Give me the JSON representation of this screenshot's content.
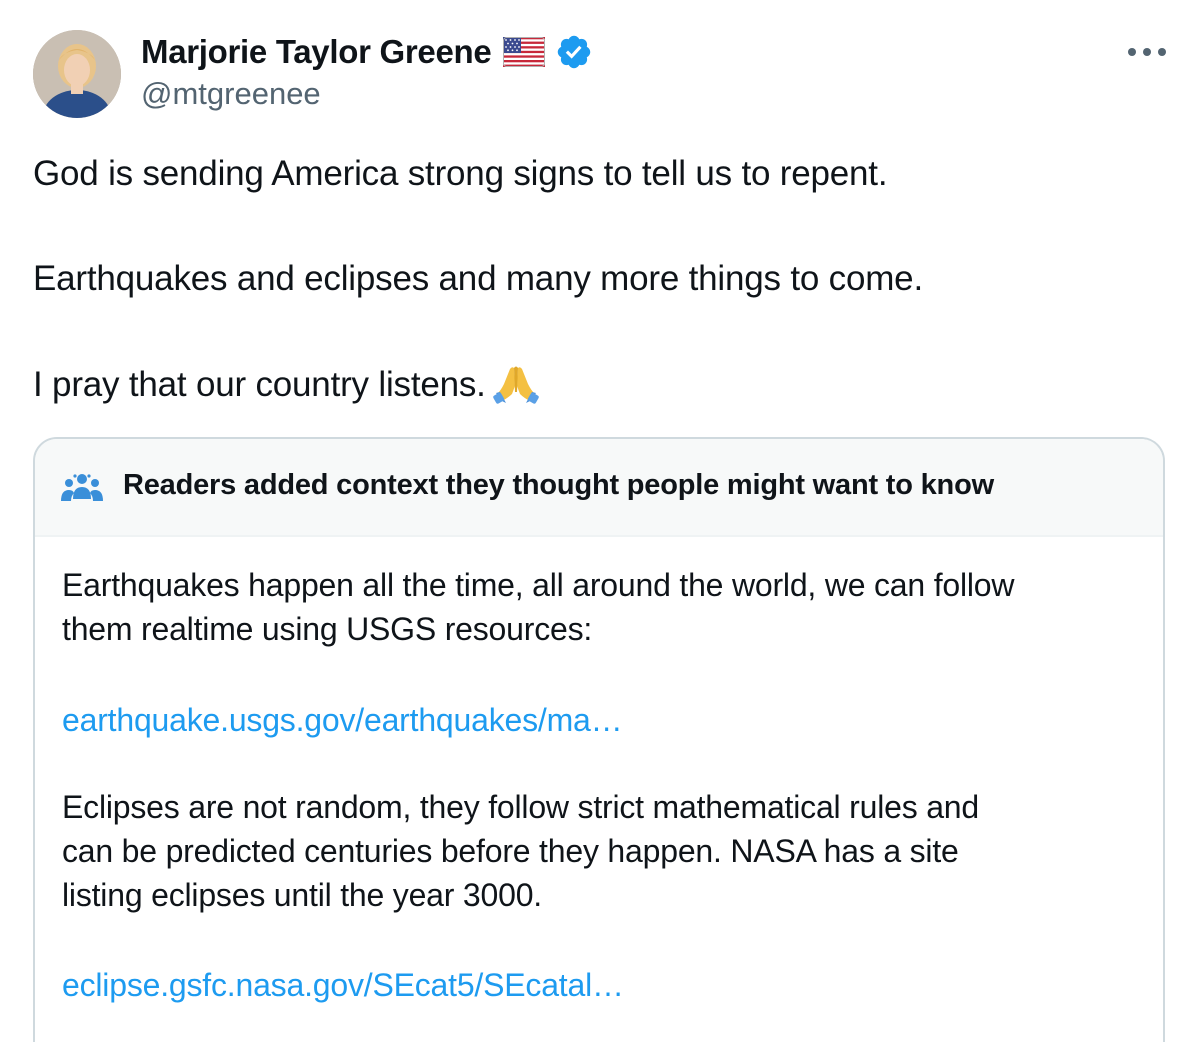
{
  "author": {
    "display_name": "Marjorie Taylor Greene",
    "handle": "@mtgreenee",
    "flag_icon": "us-flag-icon",
    "verified_icon": "verified-badge-icon",
    "verified_color": "#1d9bf0"
  },
  "menu": {
    "icon": "more-horizontal-icon"
  },
  "tweet": {
    "lines": [
      "God is sending America strong signs to tell us to repent.",
      "Earthquakes and eclipses and many more things to come.",
      "I pray that our country listens."
    ],
    "emoji": "folded-hands-icon"
  },
  "community_note": {
    "icon": "people-icon",
    "title": "Readers added context they thought people might want to know",
    "paragraph1": [
      "Earthquakes happen all the time, all around the world, we can follow",
      "them realtime using USGS resources:"
    ],
    "link1": "earthquake.usgs.gov/earthquakes/ma…",
    "paragraph2": [
      "Eclipses are not random, they follow strict mathematical rules and",
      "can be predicted centuries before they happen. NASA has a site",
      "listing eclipses until the year 3000."
    ],
    "link2": "eclipse.gsfc.nasa.gov/SEcat5/SEcatal…",
    "link_color": "#1d9bf0",
    "header_bg": "#f7f9f9"
  }
}
